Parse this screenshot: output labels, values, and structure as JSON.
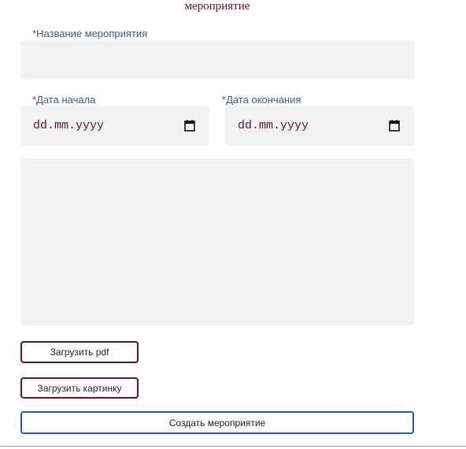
{
  "heading": "мероприятие",
  "fields": {
    "name": {
      "required_mark": "*",
      "label": "Название мероприятия",
      "value": ""
    },
    "start_date": {
      "required_mark": "*",
      "label": "Дата начала",
      "value_display": "dd.mm.yyyy",
      "icon": "calendar-icon"
    },
    "end_date": {
      "required_mark": "*",
      "label": "Дата окончания",
      "value_display": "dd.mm.yyyy",
      "icon": "calendar-icon"
    },
    "description": {
      "value": ""
    }
  },
  "buttons": {
    "upload_pdf": "Загрузить pdf",
    "upload_image": "Загрузить картинку",
    "create_event": "Создать мероприятие"
  },
  "colors": {
    "heading": "#5c1240",
    "label": "#3e5a80",
    "required_mark": "#c0162c",
    "input_background": "#f2f2f2",
    "upload_button_border": "#5c1240",
    "create_button_border": "#1d5fa8"
  }
}
